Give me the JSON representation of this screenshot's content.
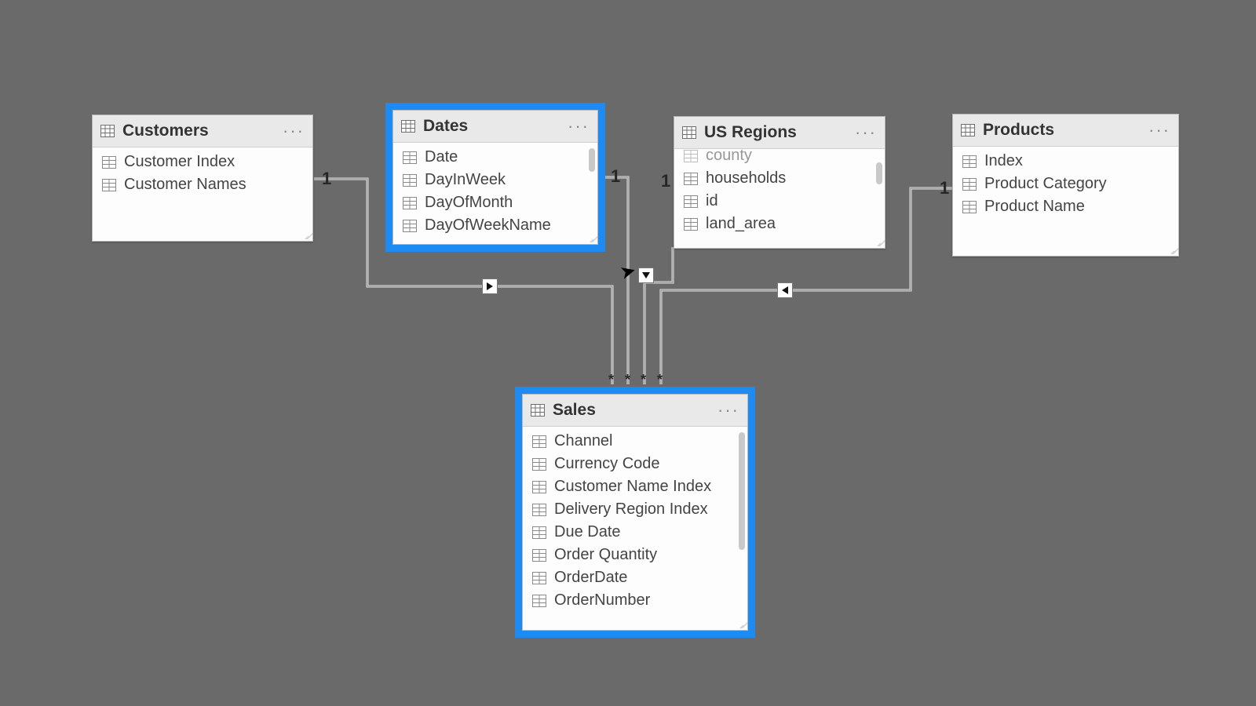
{
  "tables": {
    "customers": {
      "title": "Customers",
      "fields": [
        "Customer Index",
        "Customer Names"
      ]
    },
    "dates": {
      "title": "Dates",
      "fields": [
        "Date",
        "DayInWeek",
        "DayOfMonth",
        "DayOfWeekName"
      ]
    },
    "usregions": {
      "title": "US Regions",
      "fields": [
        "county",
        "households",
        "id",
        "land_area"
      ]
    },
    "products": {
      "title": "Products",
      "fields": [
        "Index",
        "Product Category",
        "Product Name"
      ]
    },
    "sales": {
      "title": "Sales",
      "fields": [
        "Channel",
        "Currency Code",
        "Customer Name Index",
        "Delivery Region Index",
        "Due Date",
        "Order Quantity",
        "OrderDate",
        "OrderNumber"
      ]
    }
  },
  "cardinality": {
    "one": "1",
    "many": "*"
  },
  "relationships": [
    {
      "from": "customers",
      "to": "sales",
      "from_card": "1",
      "to_card": "*",
      "direction": "to"
    },
    {
      "from": "dates",
      "to": "sales",
      "from_card": "1",
      "to_card": "*",
      "direction": "to"
    },
    {
      "from": "usregions",
      "to": "sales",
      "from_card": "1",
      "to_card": "*",
      "direction": "to"
    },
    {
      "from": "products",
      "to": "sales",
      "from_card": "1",
      "to_card": "*",
      "direction": "to"
    }
  ],
  "selected_tables": [
    "dates",
    "sales"
  ],
  "highlight_color": "#1d8bf1"
}
